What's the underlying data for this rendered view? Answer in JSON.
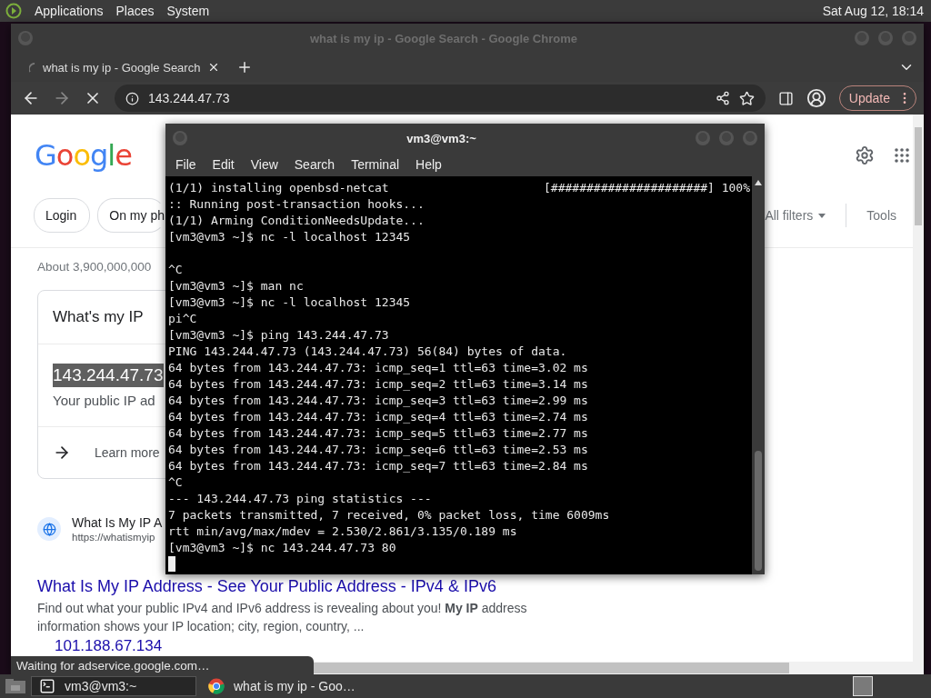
{
  "top_panel": {
    "menus": [
      "Applications",
      "Places",
      "System"
    ],
    "clock": "Sat Aug 12, 18:14"
  },
  "browser": {
    "window_title": "what is my ip - Google Search - Google Chrome",
    "tabs": [
      {
        "label": "what is my ip - Google Search",
        "selected": true
      }
    ],
    "toolbar": {
      "url": "143.244.47.73",
      "loading": true,
      "update_label": "Update"
    },
    "page": {
      "logo": "Google",
      "chips": [
        "Login",
        "On my ph"
      ],
      "all_filters": "All filters",
      "tools": "Tools",
      "result_stats": "About 3,900,000,000",
      "answer_card": {
        "title": "What's my IP",
        "ip": "143.244.47.73",
        "ip_selected": true,
        "caption": "Your public IP ad",
        "link": "Learn more"
      },
      "result": {
        "site": "What Is My IP A",
        "url": "https://whatismyip",
        "title": "What Is My IP Address - See Your Public Address - IPv4 & IPv6",
        "snippet": "Find out what your public IPv4 and IPv6 address is revealing about you! **My IP** address information shows your IP location; city, region, country, ..."
      },
      "next_ip": "101.188.67.134"
    },
    "status": "Waiting for adservice.google.com…"
  },
  "terminal": {
    "title": "vm3@vm3:~",
    "menus": [
      "File",
      "Edit",
      "View",
      "Search",
      "Terminal",
      "Help"
    ],
    "lines": [
      {
        "kind": "progress",
        "text": "(1/1) installing openbsd-netcat",
        "bar": "[######################] 100%"
      },
      {
        "kind": "text",
        "text": ":: Running post-transaction hooks..."
      },
      {
        "kind": "text",
        "text": "(1/1) Arming ConditionNeedsUpdate..."
      },
      {
        "kind": "text",
        "text": "[vm3@vm3 ~]$ nc -l localhost 12345"
      },
      {
        "kind": "blank"
      },
      {
        "kind": "text",
        "text": "^C"
      },
      {
        "kind": "text",
        "text": "[vm3@vm3 ~]$ man nc"
      },
      {
        "kind": "text",
        "text": "[vm3@vm3 ~]$ nc -l localhost 12345"
      },
      {
        "kind": "text",
        "text": "pi^C"
      },
      {
        "kind": "text",
        "text": "[vm3@vm3 ~]$ ping 143.244.47.73"
      },
      {
        "kind": "text",
        "text": "PING 143.244.47.73 (143.244.47.73) 56(84) bytes of data."
      },
      {
        "kind": "text",
        "text": "64 bytes from 143.244.47.73: icmp_seq=1 ttl=63 time=3.02 ms"
      },
      {
        "kind": "text",
        "text": "64 bytes from 143.244.47.73: icmp_seq=2 ttl=63 time=3.14 ms"
      },
      {
        "kind": "text",
        "text": "64 bytes from 143.244.47.73: icmp_seq=3 ttl=63 time=2.99 ms"
      },
      {
        "kind": "text",
        "text": "64 bytes from 143.244.47.73: icmp_seq=4 ttl=63 time=2.74 ms"
      },
      {
        "kind": "text",
        "text": "64 bytes from 143.244.47.73: icmp_seq=5 ttl=63 time=2.77 ms"
      },
      {
        "kind": "text",
        "text": "64 bytes from 143.244.47.73: icmp_seq=6 ttl=63 time=2.53 ms"
      },
      {
        "kind": "text",
        "text": "64 bytes from 143.244.47.73: icmp_seq=7 ttl=63 time=2.84 ms"
      },
      {
        "kind": "text",
        "text": "^C"
      },
      {
        "kind": "text",
        "text": "--- 143.244.47.73 ping statistics ---"
      },
      {
        "kind": "text",
        "text": "7 packets transmitted, 7 received, 0% packet loss, time 6009ms"
      },
      {
        "kind": "text",
        "text": "rtt min/avg/max/mdev = 2.530/2.861/3.135/0.189 ms"
      },
      {
        "kind": "text",
        "text": "[vm3@vm3 ~]$ nc 143.244.47.73 80"
      },
      {
        "kind": "cursor"
      }
    ]
  },
  "taskbar": {
    "items": [
      {
        "kind": "terminal",
        "label": "vm3@vm3:~",
        "selected": true
      },
      {
        "kind": "browser",
        "label": "what is my ip - Goo…",
        "selected": false
      }
    ]
  }
}
